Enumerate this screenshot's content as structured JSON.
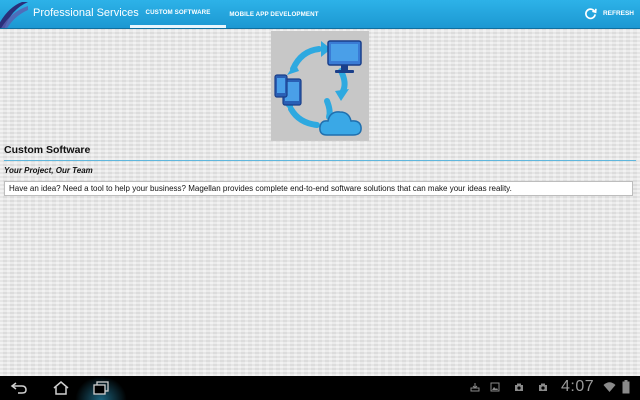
{
  "actionbar": {
    "title": "Professional Services",
    "tabs": [
      {
        "label": "CUSTOM SOFTWARE",
        "active": true
      },
      {
        "label": "MOBILE APP DEVELOPMENT",
        "active": false
      }
    ],
    "refresh_label": "REFRESH",
    "accent": "#1c98d2"
  },
  "content": {
    "section_title": "Custom Software",
    "subtitle": "Your Project, Our Team",
    "body": "Have an idea?  Need a tool to help your business?  Magellan provides complete end-to-end software solutions that can make your ideas reality.",
    "hero_icons": [
      "monitor-icon",
      "tablet-icon",
      "phone-icon",
      "cloud-icon",
      "cycle-arrows-icon"
    ]
  },
  "system_bar": {
    "clock": "4:07",
    "nav_icons": [
      "back-icon",
      "home-icon",
      "recent-apps-icon"
    ],
    "status_icons": [
      "download-icon",
      "gallery-icon",
      "camera-icon",
      "camera-icon",
      "wifi-icon",
      "battery-icon"
    ]
  }
}
